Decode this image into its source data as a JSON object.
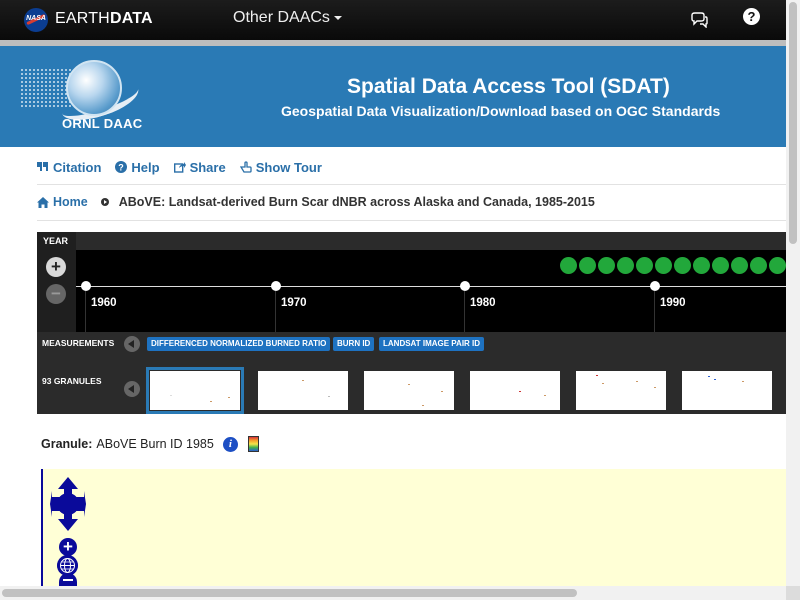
{
  "topbar": {
    "brand_light": "EARTH",
    "brand_bold": "DATA",
    "logo_text": "NASA",
    "other_daacs": "Other DAACs",
    "help_glyph": "?"
  },
  "banner": {
    "org": "ORNL DAAC",
    "title": "Spatial Data Access Tool (SDAT)",
    "subtitle": "Geospatial Data Visualization/Download based on OGC Standards"
  },
  "links": [
    {
      "label": "Citation",
      "icon": "quote-icon"
    },
    {
      "label": "Help",
      "icon": "question-circle-icon"
    },
    {
      "label": "Share",
      "icon": "share-icon"
    },
    {
      "label": "Show Tour",
      "icon": "hand-pointer-icon"
    }
  ],
  "breadcrumb": {
    "home": "Home",
    "current": "ABoVE: Landsat-derived Burn Scar dNBR across Alaska and Canada, 1985-2015"
  },
  "timeline": {
    "year_label": "YEAR",
    "zoom_in": "+",
    "zoom_out": "−",
    "years": [
      "1960",
      "1970",
      "1980",
      "1990"
    ]
  },
  "measurements": {
    "label": "MEASUREMENTS",
    "items": [
      "DIFFERENCED NORMALIZED BURNED RATIO",
      "BURN ID",
      "LANDSAT IMAGE PAIR ID"
    ]
  },
  "granules": {
    "label": "93 GRANULES"
  },
  "granule_info": {
    "label": "Granule:",
    "value": "ABoVE Burn ID 1985",
    "info_glyph": "i"
  },
  "map_controls": {
    "zoom_in": "+"
  },
  "colors": {
    "brand_blue": "#2a7ab5",
    "link_blue": "#2a6fa8",
    "granule_dot_green": "#22a83b",
    "measurement_pill": "#1e72c1",
    "map_background": "#ffffd6"
  }
}
